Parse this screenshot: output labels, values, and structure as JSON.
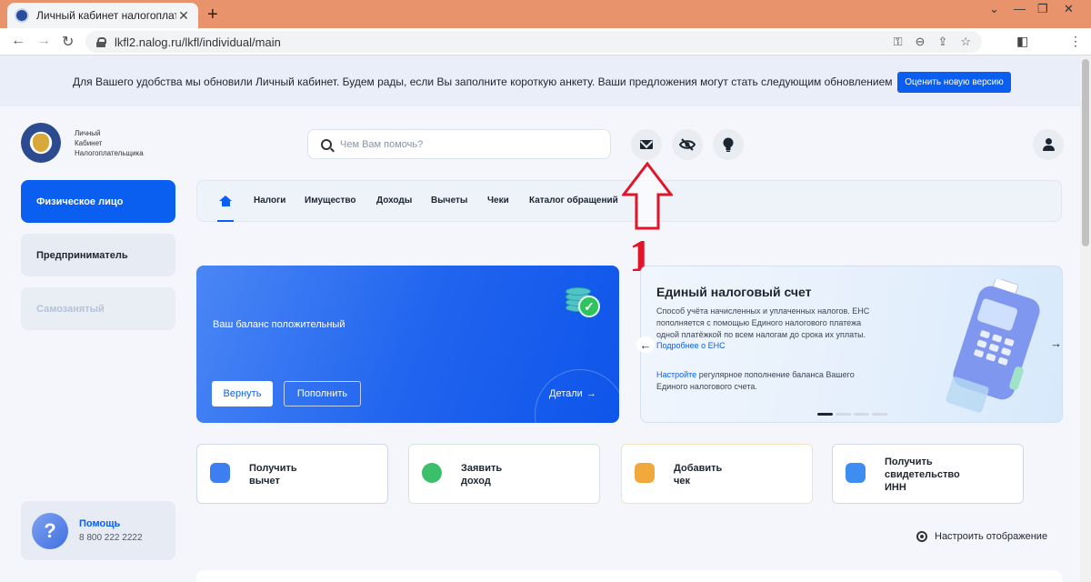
{
  "browser": {
    "tab_title": "Личный кабинет налогоплатель",
    "url": "lkfl2.nalog.ru/lkfl/individual/main"
  },
  "banner": {
    "text": "Для Вашего удобства мы обновили Личный кабинет. Будем рады, если Вы заполните короткую анкету. Ваши предложения могут стать следующим обновлением",
    "button": "Оценить новую версию"
  },
  "header": {
    "brand_line1": "Личный",
    "brand_line2": "Кабинет",
    "brand_line3": "Налогоплательщика",
    "search_placeholder": "Чем Вам помочь?"
  },
  "sidebar": {
    "items": [
      {
        "label": "Физическое лицо",
        "state": "active"
      },
      {
        "label": "Предприниматель",
        "state": "normal"
      },
      {
        "label": "Самозанятый",
        "state": "disabled"
      }
    ],
    "help_title": "Помощь",
    "help_phone": "8 800 222 2222"
  },
  "nav": {
    "items": [
      "Налоги",
      "Имущество",
      "Доходы",
      "Вычеты",
      "Чеки",
      "Каталог обращений"
    ]
  },
  "annotation": {
    "number": "1"
  },
  "balance_card": {
    "text": "Ваш баланс положительный",
    "return_button": "Вернуть",
    "topup_button": "Пополнить",
    "details_link": "Детали"
  },
  "ens_card": {
    "title": "Единый налоговый счет",
    "description": "Способ учёта начисленных и уплаченных налогов. ЕНС пополняется с помощью Единого налогового платежа одной платёжкой по всем налогам до срока их уплаты.",
    "more_link": "Подробнее о ЕНС",
    "setup_link": "Настройте",
    "setup_text": " регулярное пополнение баланса Вашего Единого налогового счета."
  },
  "quick_actions": [
    {
      "line1": "Получить",
      "line2": "вычет",
      "line3": "",
      "color": "#3d7ef0"
    },
    {
      "line1": "Заявить",
      "line2": "доход",
      "line3": "",
      "color": "#3cbf6a"
    },
    {
      "line1": "Добавить",
      "line2": "чек",
      "line3": "",
      "color": "#f2a93b"
    },
    {
      "line1": "Получить",
      "line2": "свидетельство",
      "line3": "ИНН",
      "color": "#3d8ef0"
    }
  ],
  "settings_label": "Настроить отображение",
  "colors": {
    "accent": "#0a5ef0",
    "annotation": "#e1152a",
    "tab_bar": "#e8936b"
  }
}
